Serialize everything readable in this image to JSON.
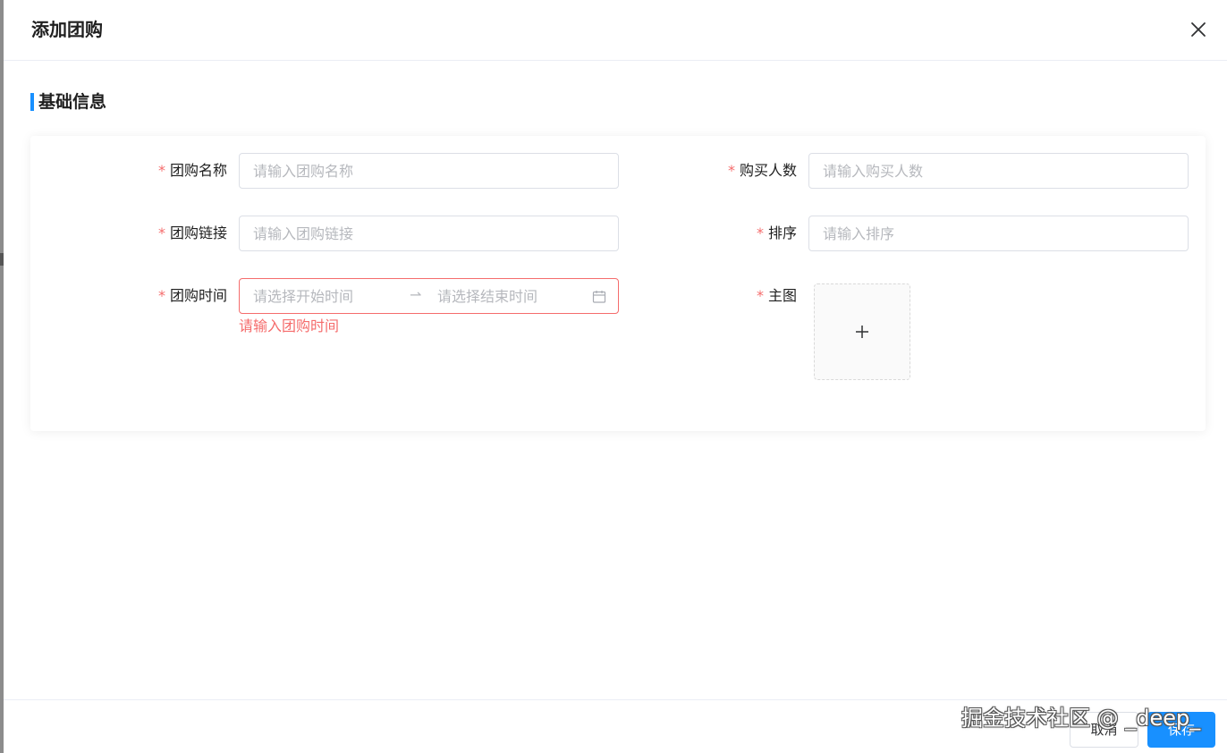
{
  "dialog": {
    "title": "添加团购"
  },
  "section": {
    "title": "基础信息"
  },
  "form": {
    "required_mark": "*",
    "name": {
      "label": "团购名称",
      "placeholder": "请输入团购名称",
      "value": ""
    },
    "link": {
      "label": "团购链接",
      "placeholder": "请输入团购链接",
      "value": ""
    },
    "time": {
      "label": "团购时间",
      "start_placeholder": "请选择开始时间",
      "end_placeholder": "请选择结束时间",
      "separator": "⇀",
      "error": "请输入团购时间"
    },
    "buyers": {
      "label": "购买人数",
      "placeholder": "请输入购买人数",
      "value": ""
    },
    "sort": {
      "label": "排序",
      "placeholder": "请输入排序",
      "value": ""
    },
    "main_image": {
      "label": "主图"
    }
  },
  "footer": {
    "cancel_label": "取消",
    "save_label": "保存"
  },
  "watermark": {
    "text": "掘金技术社区 @ _deep_"
  },
  "colors": {
    "primary": "#1890ff",
    "danger": "#f56c6c",
    "border": "#dcdfe6",
    "placeholder": "#b6b8bd"
  },
  "icons": {
    "close": "close-icon",
    "calendar": "calendar-icon",
    "plus": "plus-icon"
  }
}
